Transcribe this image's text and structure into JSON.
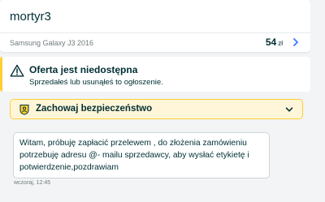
{
  "header": {
    "username": "mortyr3",
    "product_title": "Samsung Galaxy J3 2016",
    "price_value": "54",
    "price_currency": "zł"
  },
  "offer_status": {
    "title": "Oferta jest niedostępna",
    "subtitle": "Sprzedałeś lub usunąłeś to ogłoszenie."
  },
  "safety": {
    "label": "Zachowaj bezpieczeństwo"
  },
  "messages": [
    {
      "text": "Witam, próbuję zapłacić przelewem , do złożenia zamówieniu potrzebuję adresu @- mailu sprzedawcy, aby wysłać etykietę i potwierdzenie,pozdrawiam",
      "time": "wczoraj, 12:45"
    }
  ],
  "icons": {
    "warning": "warning-icon",
    "shield": "shield-icon",
    "chevron_right": "chevron-right-icon",
    "chevron_down": "chevron-down-icon"
  },
  "colors": {
    "accent_yellow": "#ffce32",
    "safety_bg": "#fff6d9",
    "text_primary": "#002f34",
    "text_muted": "#6f7b7d",
    "link_blue": "#3a77ff"
  }
}
